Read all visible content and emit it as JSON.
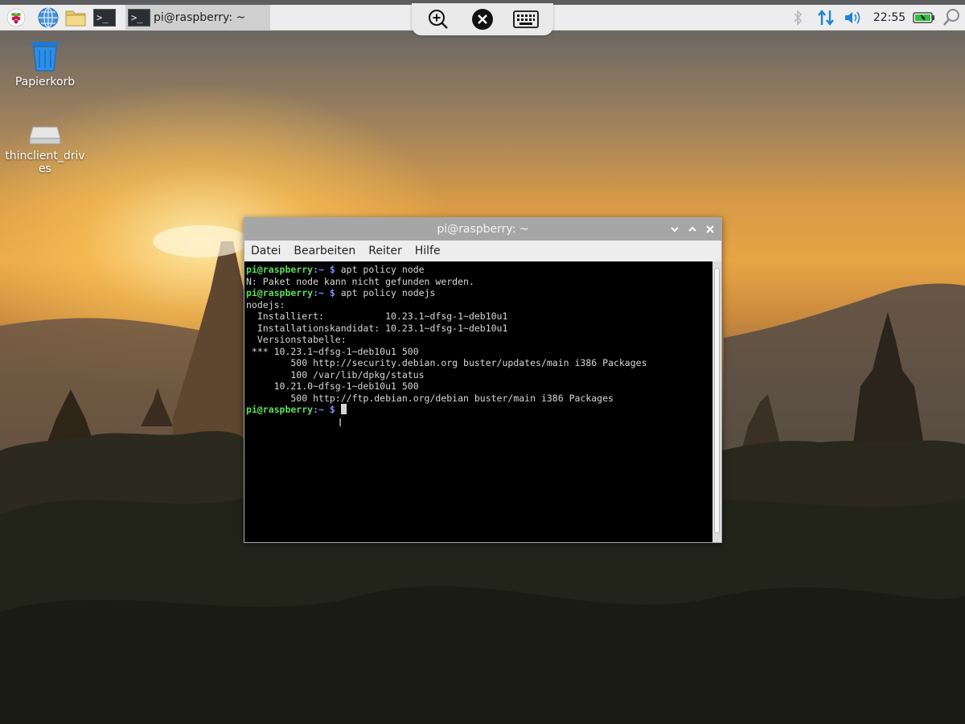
{
  "taskbar": {
    "task_label": "pi@raspberry: ~",
    "term_glyph": ">_",
    "clock": "22:55",
    "icons": [
      "raspberry-menu-icon",
      "web-browser-icon",
      "file-manager-icon",
      "terminal-icon",
      "bluetooth-icon",
      "network-icon",
      "volume-icon",
      "battery-icon",
      "search-icon"
    ]
  },
  "remote_toolbar": {
    "icons": [
      "zoom-in-icon",
      "remote-desktop-icon",
      "keyboard-icon"
    ]
  },
  "desktop": {
    "icons": [
      {
        "label": "Papierkorb",
        "icon": "trash-icon"
      },
      {
        "label": "thinclient_drives",
        "icon": "drive-icon"
      }
    ]
  },
  "terminal_window": {
    "title": "pi@raspberry: ~",
    "menu": [
      "Datei",
      "Bearbeiten",
      "Reiter",
      "Hilfe"
    ],
    "prompt_user": "pi@raspberry",
    "prompt_path": ":~",
    "prompt_symbol": " $ ",
    "lines": [
      {
        "type": "cmd",
        "text": "apt policy node"
      },
      {
        "type": "out",
        "text": "N: Paket node kann nicht gefunden werden."
      },
      {
        "type": "cmd",
        "text": "apt policy nodejs"
      },
      {
        "type": "out",
        "text": "nodejs:"
      },
      {
        "type": "out",
        "text": "  Installiert:           10.23.1~dfsg-1~deb10u1"
      },
      {
        "type": "out",
        "text": "  Installationskandidat: 10.23.1~dfsg-1~deb10u1"
      },
      {
        "type": "out",
        "text": "  Versionstabelle:"
      },
      {
        "type": "out",
        "text": " *** 10.23.1~dfsg-1~deb10u1 500"
      },
      {
        "type": "out",
        "text": "        500 http://security.debian.org buster/updates/main i386 Packages"
      },
      {
        "type": "out",
        "text": "        100 /var/lib/dpkg/status"
      },
      {
        "type": "out",
        "text": "     10.21.0~dfsg-1~deb10u1 500"
      },
      {
        "type": "out",
        "text": "        500 http://ftp.debian.org/debian buster/main i386 Packages"
      },
      {
        "type": "cmd",
        "text": ""
      }
    ]
  }
}
